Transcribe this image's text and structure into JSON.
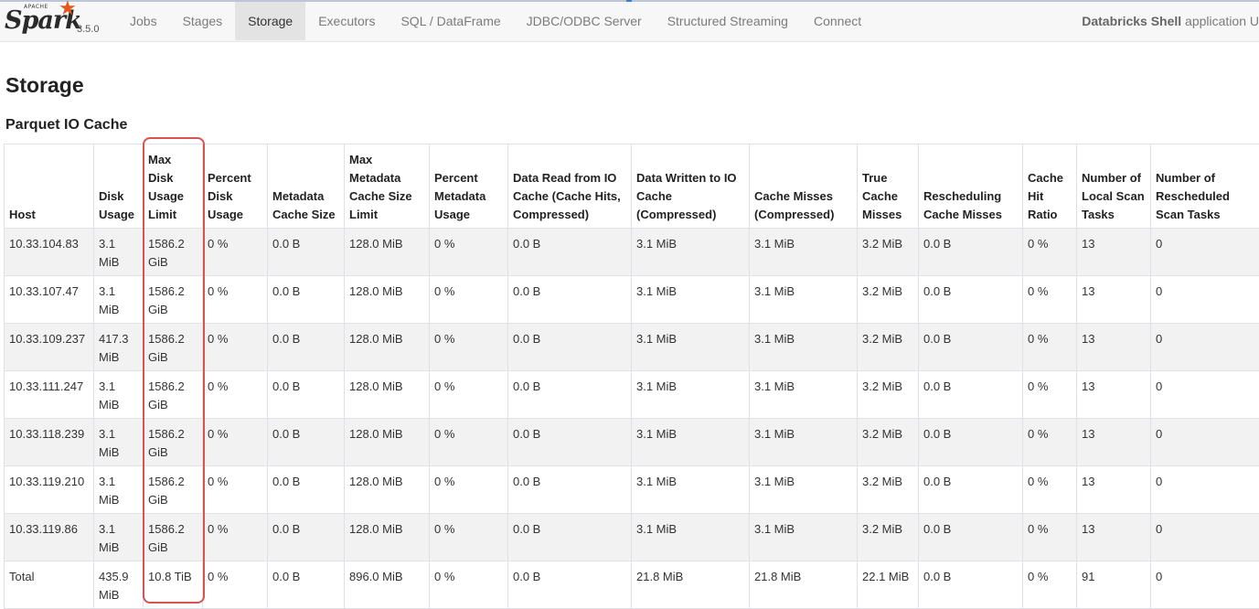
{
  "brand": {
    "apache": "APACHE",
    "name": "Spark",
    "version": "3.5.0"
  },
  "nav": {
    "tabs": [
      "Jobs",
      "Stages",
      "Storage",
      "Executors",
      "SQL / DataFrame",
      "JDBC/ODBC Server",
      "Structured Streaming",
      "Connect"
    ],
    "active": "Storage"
  },
  "app": {
    "name": "Databricks Shell",
    "suffix": " application U"
  },
  "page": {
    "title": "Storage",
    "section": "Parquet IO Cache"
  },
  "table": {
    "headers": [
      "Host",
      "Disk Usage",
      "Max Disk Usage Limit",
      "Percent Disk Usage",
      "Metadata Cache Size",
      "Max Metadata Cache Size Limit",
      "Percent Metadata Usage",
      "Data Read from IO Cache (Cache Hits, Compressed)",
      "Data Written to IO Cache (Compressed)",
      "Cache Misses (Compressed)",
      "True Cache Misses",
      "Rescheduling Cache Misses",
      "Cache Hit Ratio",
      "Number of Local Scan Tasks",
      "Number of Rescheduled Scan Tasks"
    ],
    "rows": [
      [
        "10.33.104.83",
        "3.1 MiB",
        "1586.2 GiB",
        "0 %",
        "0.0 B",
        "128.0 MiB",
        "0 %",
        "0.0 B",
        "3.1 MiB",
        "3.1 MiB",
        "3.2 MiB",
        "0.0 B",
        "0 %",
        "13",
        "0"
      ],
      [
        "10.33.107.47",
        "3.1 MiB",
        "1586.2 GiB",
        "0 %",
        "0.0 B",
        "128.0 MiB",
        "0 %",
        "0.0 B",
        "3.1 MiB",
        "3.1 MiB",
        "3.2 MiB",
        "0.0 B",
        "0 %",
        "13",
        "0"
      ],
      [
        "10.33.109.237",
        "417.3 MiB",
        "1586.2 GiB",
        "0 %",
        "0.0 B",
        "128.0 MiB",
        "0 %",
        "0.0 B",
        "3.1 MiB",
        "3.1 MiB",
        "3.2 MiB",
        "0.0 B",
        "0 %",
        "13",
        "0"
      ],
      [
        "10.33.111.247",
        "3.1 MiB",
        "1586.2 GiB",
        "0 %",
        "0.0 B",
        "128.0 MiB",
        "0 %",
        "0.0 B",
        "3.1 MiB",
        "3.1 MiB",
        "3.2 MiB",
        "0.0 B",
        "0 %",
        "13",
        "0"
      ],
      [
        "10.33.118.239",
        "3.1 MiB",
        "1586.2 GiB",
        "0 %",
        "0.0 B",
        "128.0 MiB",
        "0 %",
        "0.0 B",
        "3.1 MiB",
        "3.1 MiB",
        "3.2 MiB",
        "0.0 B",
        "0 %",
        "13",
        "0"
      ],
      [
        "10.33.119.210",
        "3.1 MiB",
        "1586.2 GiB",
        "0 %",
        "0.0 B",
        "128.0 MiB",
        "0 %",
        "0.0 B",
        "3.1 MiB",
        "3.1 MiB",
        "3.2 MiB",
        "0.0 B",
        "0 %",
        "13",
        "0"
      ],
      [
        "10.33.119.86",
        "3.1 MiB",
        "1586.2 GiB",
        "0 %",
        "0.0 B",
        "128.0 MiB",
        "0 %",
        "0.0 B",
        "3.1 MiB",
        "3.1 MiB",
        "3.2 MiB",
        "0.0 B",
        "0 %",
        "13",
        "0"
      ],
      [
        "Total",
        "435.9 MiB",
        "10.8 TiB",
        "0 %",
        "0.0 B",
        "896.0 MiB",
        "0 %",
        "0.0 B",
        "21.8 MiB",
        "21.8 MiB",
        "22.1 MiB",
        "0.0 B",
        "0 %",
        "91",
        "0"
      ]
    ]
  },
  "colors": {
    "accent_logo": "#e25a1c",
    "highlight_box": "#d9534f",
    "row_stripe": "#f2f2f2",
    "nav_bg": "#f7f7f7"
  }
}
